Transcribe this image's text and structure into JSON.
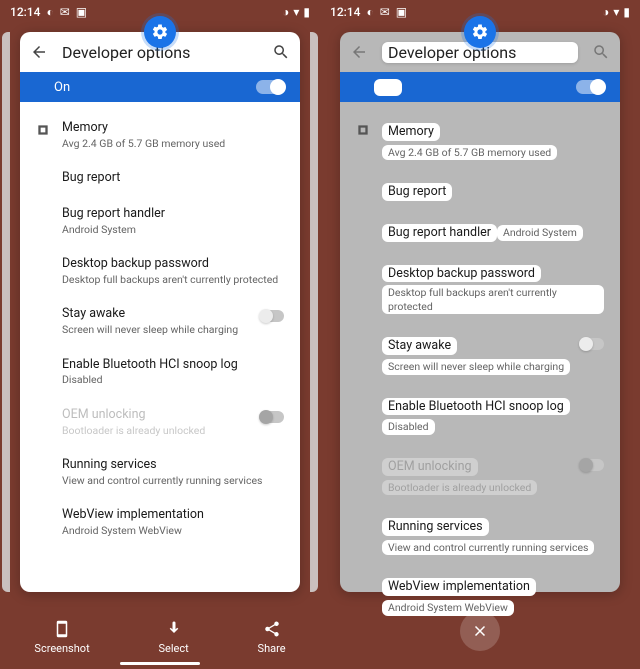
{
  "status": {
    "time": "12:14",
    "icons_left": [
      "pie-icon",
      "mail-icon",
      "picture-icon"
    ],
    "icons_right": [
      "brightness-icon",
      "wifi-icon",
      "battery-icon"
    ]
  },
  "title": "Developer options",
  "on_label": "On",
  "settings": [
    {
      "key": "memory",
      "title": "Memory",
      "sub": "Avg 2.4 GB of 5.7 GB memory used",
      "icon": "chip-icon"
    },
    {
      "key": "bug_report",
      "title": "Bug report",
      "sub": ""
    },
    {
      "key": "bug_handler",
      "title": "Bug report handler",
      "sub": "Android System"
    },
    {
      "key": "backup_pw",
      "title": "Desktop backup password",
      "sub": "Desktop full backups aren't currently protected"
    },
    {
      "key": "stay_awake",
      "title": "Stay awake",
      "sub": "Screen will never sleep while charging",
      "toggle": "off"
    },
    {
      "key": "bt_hci",
      "title": "Enable Bluetooth HCI snoop log",
      "sub": "Disabled"
    },
    {
      "key": "oem_unlock",
      "title": "OEM unlocking",
      "sub": "Bootloader is already unlocked",
      "toggle": "disabled",
      "disabled": true
    },
    {
      "key": "running_svc",
      "title": "Running services",
      "sub": "View and control currently running services"
    },
    {
      "key": "webview",
      "title": "WebView implementation",
      "sub": "Android System WebView"
    }
  ],
  "actions": {
    "screenshot": "Screenshot",
    "select": "Select",
    "share": "Share"
  }
}
